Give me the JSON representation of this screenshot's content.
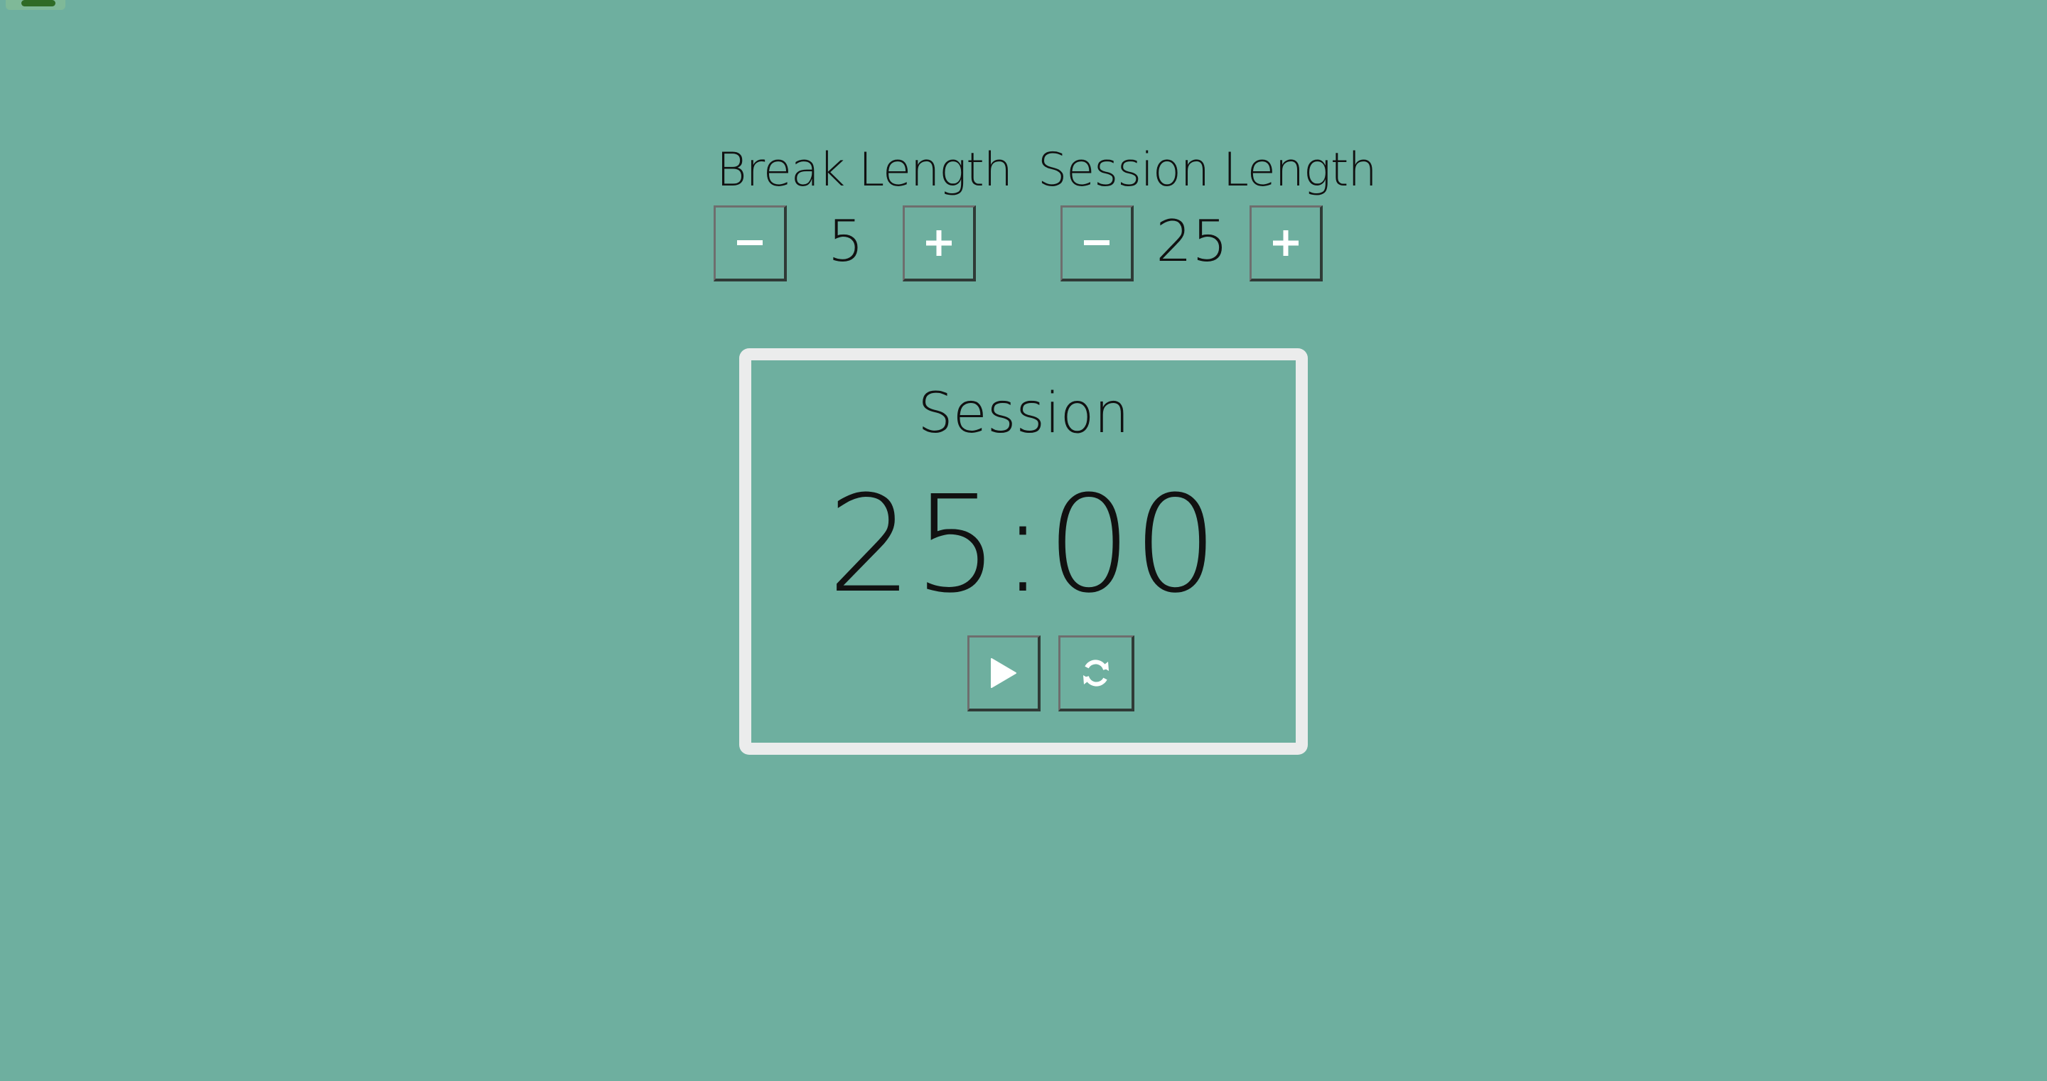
{
  "break_length": {
    "label": "Break Length",
    "value": "5",
    "decrement_icon": "minus-icon",
    "increment_icon": "plus-icon"
  },
  "session_length": {
    "label": "Session Length",
    "value": "25",
    "decrement_icon": "minus-icon",
    "increment_icon": "plus-icon"
  },
  "timer": {
    "label": "Session",
    "time": "25:00",
    "start_icon": "play-icon",
    "reset_icon": "refresh-icon"
  },
  "colors": {
    "background": "#6eaf9f",
    "timer_border": "#ebecec",
    "text": "#111111",
    "icon": "#ffffff",
    "corner_badge": "#2f6b25"
  }
}
